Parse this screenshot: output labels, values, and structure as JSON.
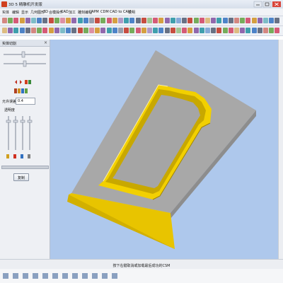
{
  "window": {
    "title": "3D 5 精雕机开发版"
  },
  "menu": [
    "实体",
    "编辑",
    "显示",
    "几何图形",
    "3D",
    "合模操作",
    "CAD",
    "加工",
    "雕刻编程",
    "APM",
    "CDM",
    "CAD to CAM",
    "说明"
  ],
  "panel": {
    "title": "实体切割",
    "close_glyph": "×",
    "param_label": "允许误差",
    "param_value": "0.4",
    "section_label": "透明度",
    "run_button": "复制"
  },
  "status": {
    "message": "按下右键取消或加载最后成功的CSM"
  },
  "colors": {
    "viewport": "#aec8ec",
    "plate": "#a9a9a9",
    "frame": "#e0c000"
  }
}
